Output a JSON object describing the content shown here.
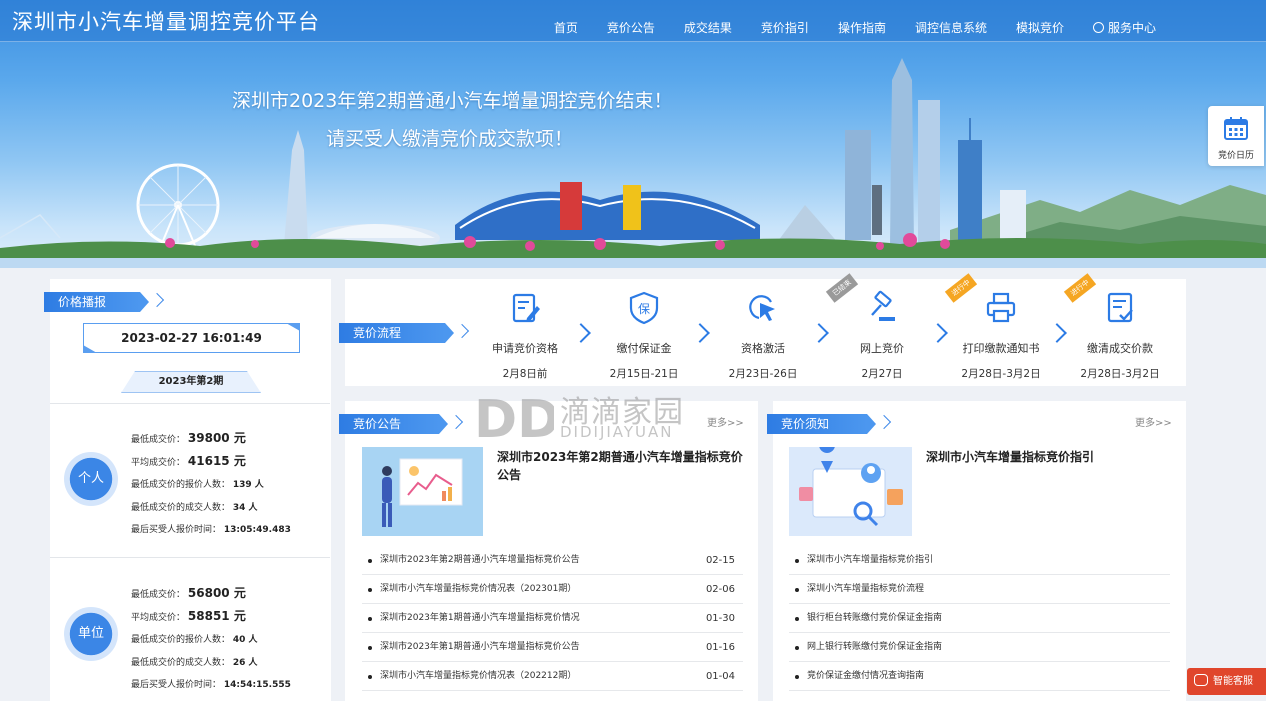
{
  "header": {
    "title": "深圳市小汽车增量调控竞价平台",
    "nav": [
      "首页",
      "竞价公告",
      "成交结果",
      "竞价指引",
      "操作指南",
      "调控信息系统",
      "模拟竞价",
      "服务中心"
    ]
  },
  "banner": {
    "headline": "深圳市2023年第2期普通小汽车增量调控竞价结束！",
    "subline": "请买受人缴清竞价成交款项！"
  },
  "side_float": {
    "calendar_label": "竞价日历"
  },
  "price_panel": {
    "ribbon": "价格播报",
    "datetime": "2023-02-27 16:01:49",
    "period": "2023年第2期",
    "groups": [
      {
        "badge": "个人",
        "min_price_label": "最低成交价：",
        "min_price": "39800 元",
        "avg_price_label": "平均成交价：",
        "avg_price": "41615 元",
        "bidders_label": "最低成交价的报价人数：",
        "bidders": "139 人",
        "deals_label": "最低成交价的成交人数：",
        "deals": "34 人",
        "last_time_label": "最后买受人报价时间：",
        "last_time": "13:05:49.483"
      },
      {
        "badge": "单位",
        "min_price_label": "最低成交价：",
        "min_price": "56800 元",
        "avg_price_label": "平均成交价：",
        "avg_price": "58851 元",
        "bidders_label": "最低成交价的报价人数：",
        "bidders": "40 人",
        "deals_label": "最低成交价的成交人数：",
        "deals": "26 人",
        "last_time_label": "最后买受人报价时间：",
        "last_time": "14:54:15.555"
      }
    ]
  },
  "process": {
    "ribbon": "竞价流程",
    "steps": [
      {
        "name": "申请竞价资格",
        "date": "2月8日前",
        "icon": "edit-document-icon",
        "tag": ""
      },
      {
        "name": "缴付保证金",
        "date": "2月15日-21日",
        "icon": "deposit-shield-icon",
        "tag": ""
      },
      {
        "name": "资格激活",
        "date": "2月23日-26日",
        "icon": "cursor-click-icon",
        "tag": ""
      },
      {
        "name": "网上竞价",
        "date": "2月27日",
        "icon": "auction-gavel-icon",
        "tag": "已结束"
      },
      {
        "name": "打印缴款通知书",
        "date": "2月28日-3月2日",
        "icon": "printer-icon",
        "tag": "进行中"
      },
      {
        "name": "缴清成交价款",
        "date": "2月28日-3月2日",
        "icon": "checklist-icon",
        "tag": "进行中"
      }
    ],
    "tag_colors": {
      "done": "#9a9a9a",
      "active": "#f5a623"
    }
  },
  "announcements": {
    "ribbon": "竞价公告",
    "more": "更多>>",
    "feature_title": "深圳市2023年第2期普通小汽车增量指标竞价公告",
    "items": [
      {
        "text": "深圳市2023年第2期普通小汽车增量指标竞价公告",
        "date": "02-15"
      },
      {
        "text": "深圳市小汽车增量指标竞价情况表（202301期）",
        "date": "02-06"
      },
      {
        "text": "深圳市2023年第1期普通小汽车增量指标竞价情况",
        "date": "01-30"
      },
      {
        "text": "深圳市2023年第1期普通小汽车增量指标竞价公告",
        "date": "01-16"
      },
      {
        "text": "深圳市小汽车增量指标竞价情况表（202212期）",
        "date": "01-04"
      }
    ]
  },
  "notices": {
    "ribbon": "竞价须知",
    "more": "更多>>",
    "feature_title": "深圳市小汽车增量指标竞价指引",
    "items": [
      {
        "text": "深圳市小汽车增量指标竞价指引"
      },
      {
        "text": "深圳小汽车增量指标竞价流程"
      },
      {
        "text": "银行柜台转账缴付竞价保证金指南"
      },
      {
        "text": "网上银行转账缴付竞价保证金指南"
      },
      {
        "text": "竞价保证金缴付情况查询指南"
      }
    ]
  },
  "watermark": {
    "mark": "DD",
    "cn": "滴滴家园",
    "en": "DIDIJIAYUAN"
  },
  "service_button": "智能客服",
  "colors": {
    "primary": "#2c7be5",
    "service": "#e0462c"
  }
}
